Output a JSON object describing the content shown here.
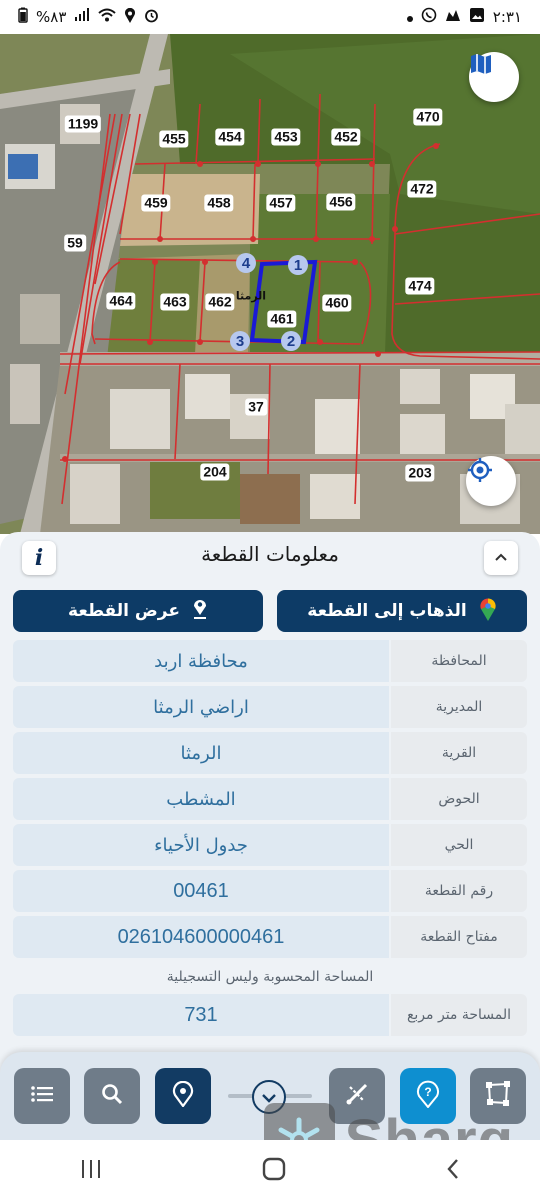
{
  "status_bar": {
    "time": "٢:٣١",
    "battery": "%٨٣",
    "signal_icons": [
      "battery-icon",
      "signal-icon",
      "wifi-icon",
      "location-icon",
      "alarm-icon"
    ],
    "notification_icons": [
      "dot-icon",
      "whatsapp-icon",
      "notification-icon",
      "gallery-icon"
    ]
  },
  "map": {
    "parcels": [
      "455",
      "454",
      "453",
      "452",
      "470",
      "459",
      "458",
      "457",
      "456",
      "472",
      "464",
      "463",
      "462",
      "461",
      "460",
      "474"
    ],
    "roads": [
      "1199",
      "59",
      "37",
      "204",
      "203"
    ],
    "village_label": "الرمثا",
    "corners": [
      "1",
      "2",
      "3",
      "4"
    ],
    "colors": {
      "parcel_lines": "#d32f2f",
      "selected_outline": "#1a1ad6"
    }
  },
  "panel": {
    "title": "معلومات القطعة",
    "goto_button": "الذهاب إلى القطعة",
    "show_button": "عرض القطعة",
    "fields": [
      {
        "label": "المحافظة",
        "value": "محافظة اربد"
      },
      {
        "label": "المديرية",
        "value": "اراضي الرمثا"
      },
      {
        "label": "القرية",
        "value": "الرمثا"
      },
      {
        "label": "الحوض",
        "value": "المشطب"
      },
      {
        "label": "الحي",
        "value": "جدول الأحياء"
      },
      {
        "label": "رقم القطعة",
        "value": "00461"
      },
      {
        "label": "مفتاح القطعة",
        "value": "026104600000461"
      }
    ],
    "area_note": "المساحة المحسوبة وليس التسجيلية",
    "area": {
      "label": "المساحة متر مربع",
      "value": "731"
    }
  },
  "toolbar": {
    "tools": [
      "list-icon",
      "search-icon",
      "location-pin-icon",
      "measure-icon",
      "help-icon",
      "polygon-icon"
    ]
  },
  "watermark": {
    "text": "Sharq"
  }
}
